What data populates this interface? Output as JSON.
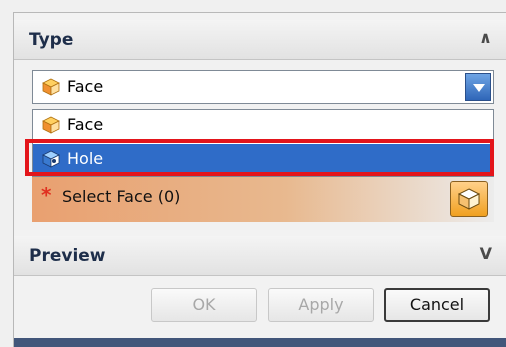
{
  "type_section": {
    "title": "Type",
    "collapse_glyph": "∧"
  },
  "combo": {
    "value": "Face",
    "icon": "face-cube-icon"
  },
  "dropdown": {
    "options": [
      {
        "label": "Face",
        "icon": "face-cube-icon",
        "selected": false
      },
      {
        "label": "Hole",
        "icon": "hole-cube-icon",
        "selected": true
      }
    ]
  },
  "select_face": {
    "required_mark": "*",
    "label": "Select Face (0)",
    "icon": "select-cube-icon"
  },
  "preview_section": {
    "title": "Preview",
    "expand_glyph": "V"
  },
  "buttons": {
    "ok": "OK",
    "apply": "Apply",
    "cancel": "Cancel"
  },
  "colors": {
    "selection": "#2f6cc8",
    "highlight_border": "#e3151b",
    "required": "#e03020"
  }
}
